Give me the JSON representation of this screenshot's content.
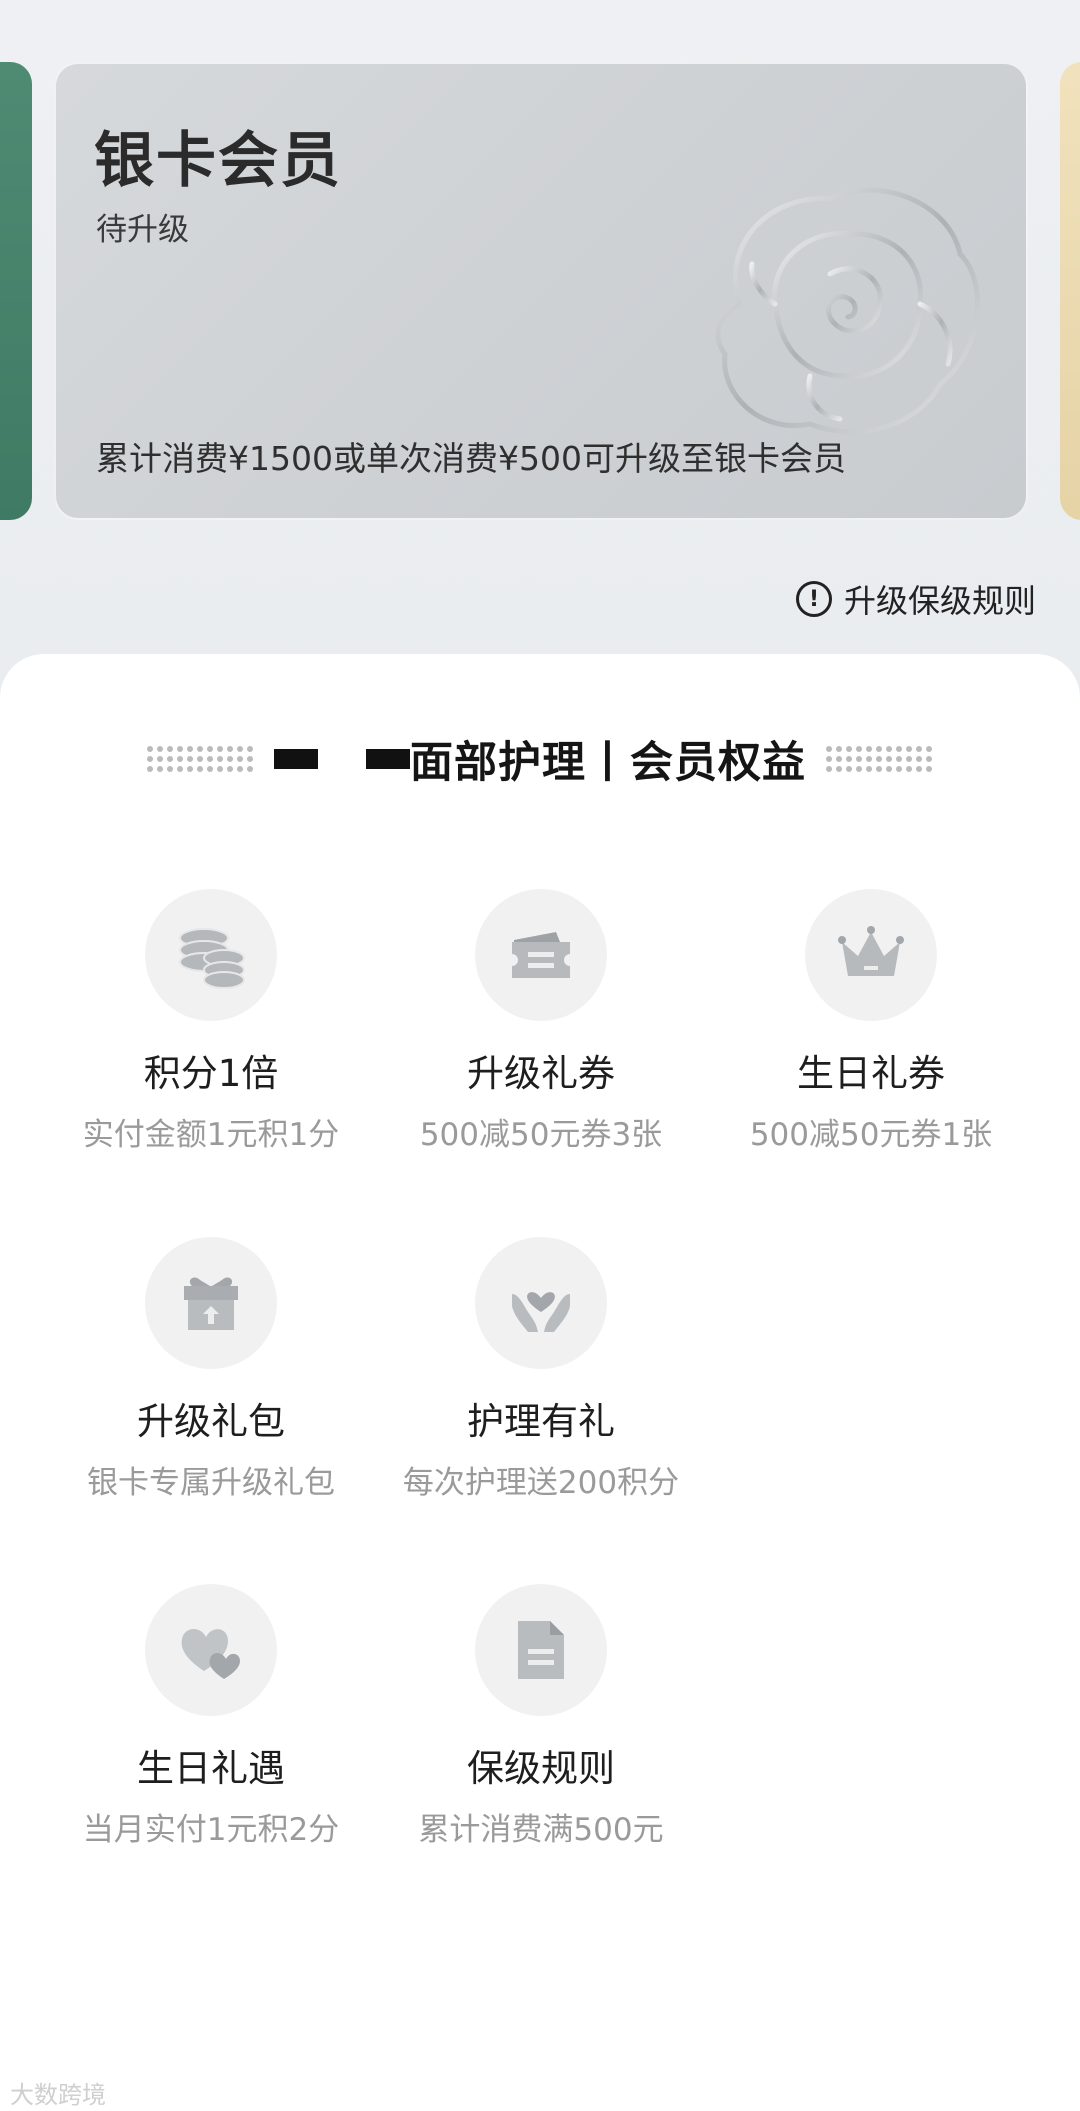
{
  "card": {
    "title": "银卡会员",
    "status": "待升级",
    "description": "累计消费¥1500或单次消费¥500可升级至银卡会员"
  },
  "rules_link": {
    "icon": "!",
    "label": "升级保级规则"
  },
  "section": {
    "title": "面部护理丨会员权益"
  },
  "benefits": [
    {
      "icon": "coins-icon",
      "name": "积分1倍",
      "sub": "实付金额1元积1分"
    },
    {
      "icon": "ticket-icon",
      "name": "升级礼券",
      "sub": "500减50元券3张"
    },
    {
      "icon": "crown-icon",
      "name": "生日礼券",
      "sub": "500减50元券1张"
    },
    {
      "icon": "gift-box-icon",
      "name": "升级礼包",
      "sub": "银卡专属升级礼包"
    },
    {
      "icon": "heart-hand-icon",
      "name": "护理有礼",
      "sub": "每次护理送200积分"
    },
    {
      "icon": "hearts-icon",
      "name": "生日礼遇",
      "sub": "当月实付1元积2分"
    },
    {
      "icon": "document-icon",
      "name": "保级规则",
      "sub": "累计消费满500元"
    }
  ],
  "watermark": "大数跨境",
  "colors": {
    "left_card": "#4f8a73",
    "right_card": "#e6d3a6",
    "silver_card": "#cfd2d5"
  }
}
